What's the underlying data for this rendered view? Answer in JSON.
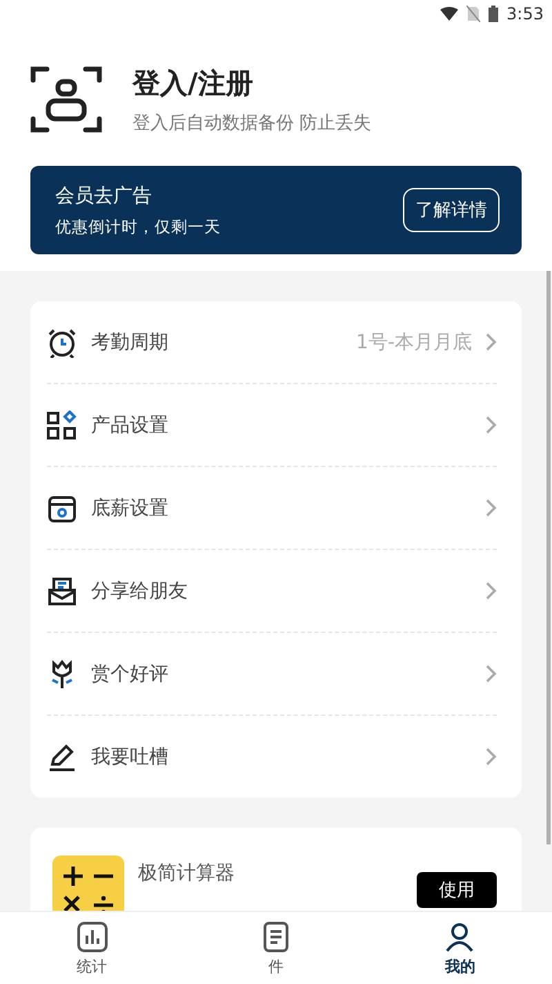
{
  "status_bar": {
    "time": "3:53"
  },
  "account": {
    "title": "登入/注册",
    "subtitle": "登入后自动数据备份 防止丢失"
  },
  "promo": {
    "title": "会员去广告",
    "subtitle": "优惠倒计时，仅剩一天",
    "button": "了解详情"
  },
  "menu": [
    {
      "kind": "alarm",
      "label": "考勤周期",
      "value": "1号-本月月底"
    },
    {
      "kind": "grid",
      "label": "产品设置"
    },
    {
      "kind": "calendar",
      "label": "底薪设置"
    },
    {
      "kind": "share",
      "label": "分享给朋友"
    },
    {
      "kind": "flower",
      "label": "赏个好评"
    },
    {
      "kind": "pen",
      "label": "我要吐槽"
    }
  ],
  "tool": {
    "name": "极简计算器",
    "button": "使用"
  },
  "tabs": [
    {
      "kind": "chart",
      "label": "统计",
      "selected": false
    },
    {
      "kind": "doc",
      "label": "件",
      "selected": false
    },
    {
      "kind": "user",
      "label": "我的",
      "selected": true
    }
  ]
}
